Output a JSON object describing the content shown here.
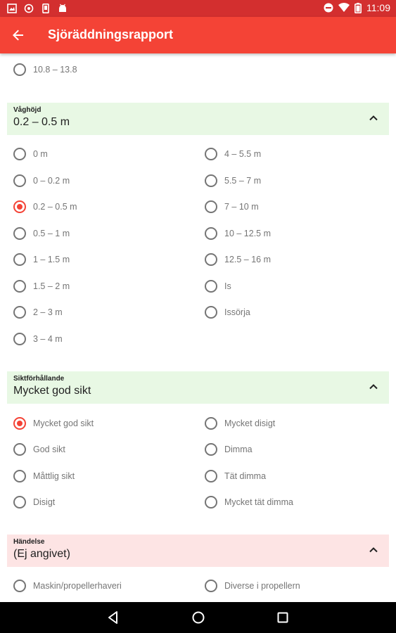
{
  "status_bar": {
    "time": "11:09",
    "left_icons": [
      "image-icon",
      "circle-target-icon",
      "phone-icon",
      "android-icon"
    ],
    "right_icons": [
      "do-not-disturb-icon",
      "wifi-icon",
      "battery-icon"
    ]
  },
  "app_bar": {
    "title": "Sjöräddningsrapport",
    "back_icon": "arrow-back-icon",
    "color": "#f44336",
    "status_color": "#d32f2f"
  },
  "prev_section": {
    "options": [
      {
        "label": "10.8 – 13.8",
        "checked": false
      }
    ]
  },
  "wave_height": {
    "label": "Våghöjd",
    "value": "0.2 – 0.5 m",
    "expanded": true,
    "col1": [
      {
        "label": "0 m",
        "checked": false
      },
      {
        "label": "0 – 0.2 m",
        "checked": false
      },
      {
        "label": "0.2 – 0.5 m",
        "checked": true
      },
      {
        "label": "0.5 – 1 m",
        "checked": false
      },
      {
        "label": "1 – 1.5 m",
        "checked": false
      },
      {
        "label": "1.5 – 2 m",
        "checked": false
      },
      {
        "label": "2 – 3 m",
        "checked": false
      },
      {
        "label": "3 – 4 m",
        "checked": false
      }
    ],
    "col2": [
      {
        "label": "4 – 5.5 m",
        "checked": false
      },
      {
        "label": "5.5 – 7 m",
        "checked": false
      },
      {
        "label": "7 – 10 m",
        "checked": false
      },
      {
        "label": "10 – 12.5 m",
        "checked": false
      },
      {
        "label": "12.5 – 16 m",
        "checked": false
      },
      {
        "label": "Is",
        "checked": false
      },
      {
        "label": "Issörja",
        "checked": false
      }
    ]
  },
  "visibility": {
    "label": "Siktförhållande",
    "value": "Mycket god sikt",
    "expanded": true,
    "col1": [
      {
        "label": "Mycket god sikt",
        "checked": true
      },
      {
        "label": "God sikt",
        "checked": false
      },
      {
        "label": "Måttlig sikt",
        "checked": false
      },
      {
        "label": "Disigt",
        "checked": false
      }
    ],
    "col2": [
      {
        "label": "Mycket disigt",
        "checked": false
      },
      {
        "label": "Dimma",
        "checked": false
      },
      {
        "label": "Tät dimma",
        "checked": false
      },
      {
        "label": "Mycket tät dimma",
        "checked": false
      }
    ]
  },
  "incident": {
    "label": "Händelse",
    "value": "(Ej angivet)",
    "expanded": true,
    "col1": [
      {
        "label": "Maskin/propellerhaveri",
        "checked": false
      }
    ],
    "col2": [
      {
        "label": "Diverse i propellern",
        "checked": false
      }
    ]
  },
  "nav_bar": {
    "icons": [
      "back-triangle-icon",
      "home-circle-icon",
      "recents-square-icon"
    ]
  }
}
